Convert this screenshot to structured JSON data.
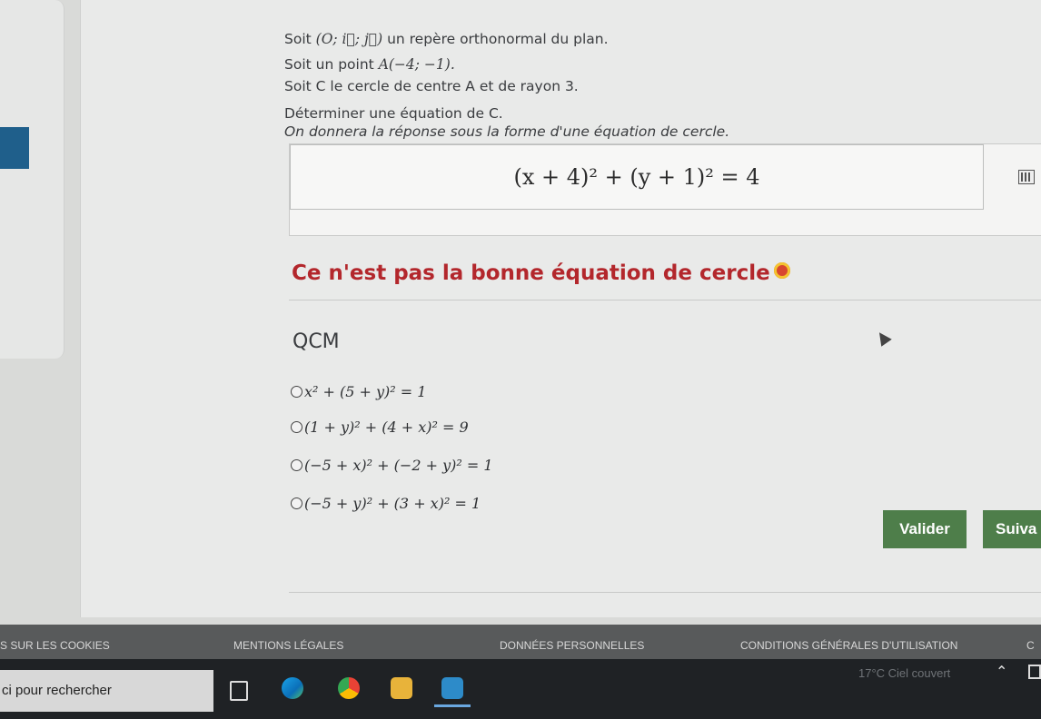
{
  "exercise": {
    "line1_prefix": "Soit",
    "line1_math": "(O; i⃗; j⃗)",
    "line1_suffix": "un repère orthonormal du plan.",
    "line2_prefix": "Soit un point",
    "line2_math": "A(−4; −1).",
    "line3": "Soit C le cercle de centre A et de rayon 3.",
    "line4": "Déterminer une équation de C.",
    "line5": "On donnera la réponse sous la forme d'une équation de cercle."
  },
  "answer": {
    "value": "(x + 4)² + (y + 1)² = 4"
  },
  "feedback": {
    "text": "Ce n'est pas la bonne équation de cercle"
  },
  "qcm": {
    "title": "QCM",
    "options": [
      "x² + (5 + y)² = 1",
      "(1 + y)² + (4 + x)² = 9",
      "(−5 + x)² + (−2 + y)² = 1",
      "(−5 + y)² + (3 + x)² = 1"
    ]
  },
  "buttons": {
    "validate": "Valider",
    "next": "Suiva"
  },
  "footer": {
    "links": [
      "S SUR LES COOKIES",
      "MENTIONS LÉGALES",
      "DONNÉES PERSONNELLES",
      "CONDITIONS GÉNÉRALES D'UTILISATION",
      "C"
    ]
  },
  "taskbar": {
    "search_placeholder": "ci pour rechercher",
    "weather": "17°C Ciel couvert"
  },
  "colors": {
    "feedback": "#b3272c",
    "button": "#4e7e4a",
    "footer": "#585a5b",
    "taskbar": "#1f2225"
  }
}
